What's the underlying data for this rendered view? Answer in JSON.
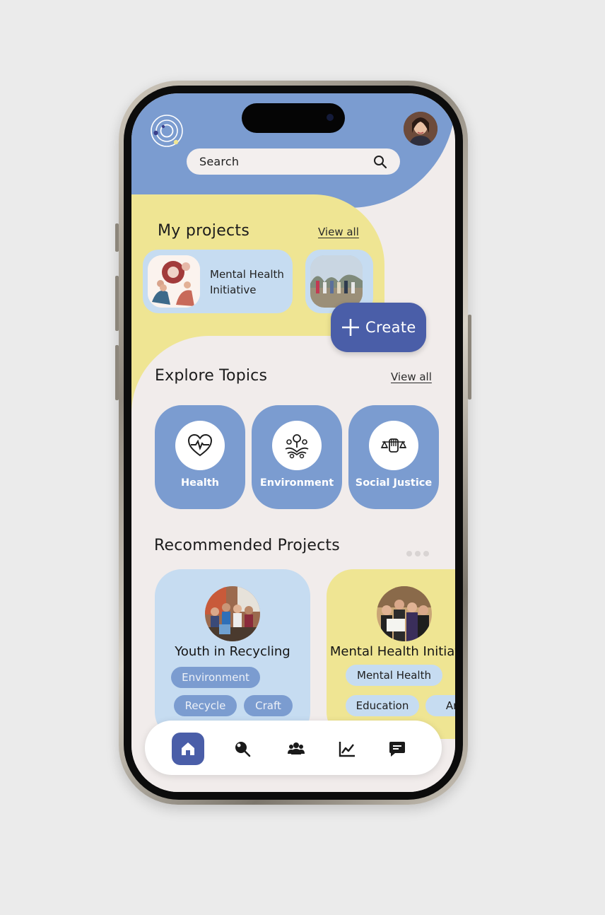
{
  "colors": {
    "primary": "#4a5ea8",
    "blue": "#7b9cd0",
    "light_blue": "#c6dcf1",
    "yellow": "#efe593",
    "background": "#f1eceb"
  },
  "header": {
    "search_placeholder": "Search",
    "logo_icon": "orbit-logo-icon",
    "avatar_icon": "user-avatar"
  },
  "my_projects": {
    "title": "My projects",
    "view_all": "View all",
    "items": [
      {
        "label": "Mental Health Initiative"
      },
      {
        "label": ""
      }
    ]
  },
  "create_button": {
    "label": "Create",
    "icon": "plus-icon"
  },
  "explore": {
    "title": "Explore Topics",
    "view_all": "View all",
    "topics": [
      {
        "label": "Health",
        "icon": "heart-pulse-icon"
      },
      {
        "label": "Environment",
        "icon": "hands-plant-icon"
      },
      {
        "label": "Social Justice",
        "icon": "justice-scales-icon"
      }
    ]
  },
  "recommended": {
    "title": "Recommended Projects",
    "cards": [
      {
        "title": "Youth in Recycling",
        "tags": [
          "Environment",
          "Recycle",
          "Craft"
        ]
      },
      {
        "title": "Mental Health Initiative",
        "tags": [
          "Mental Health",
          "Education",
          "Art"
        ]
      }
    ]
  },
  "nav": [
    {
      "name": "home",
      "icon": "home-icon",
      "active": true
    },
    {
      "name": "search",
      "icon": "search-icon",
      "active": false
    },
    {
      "name": "community",
      "icon": "people-icon",
      "active": false
    },
    {
      "name": "stats",
      "icon": "chart-icon",
      "active": false
    },
    {
      "name": "messages",
      "icon": "message-icon",
      "active": false
    }
  ]
}
